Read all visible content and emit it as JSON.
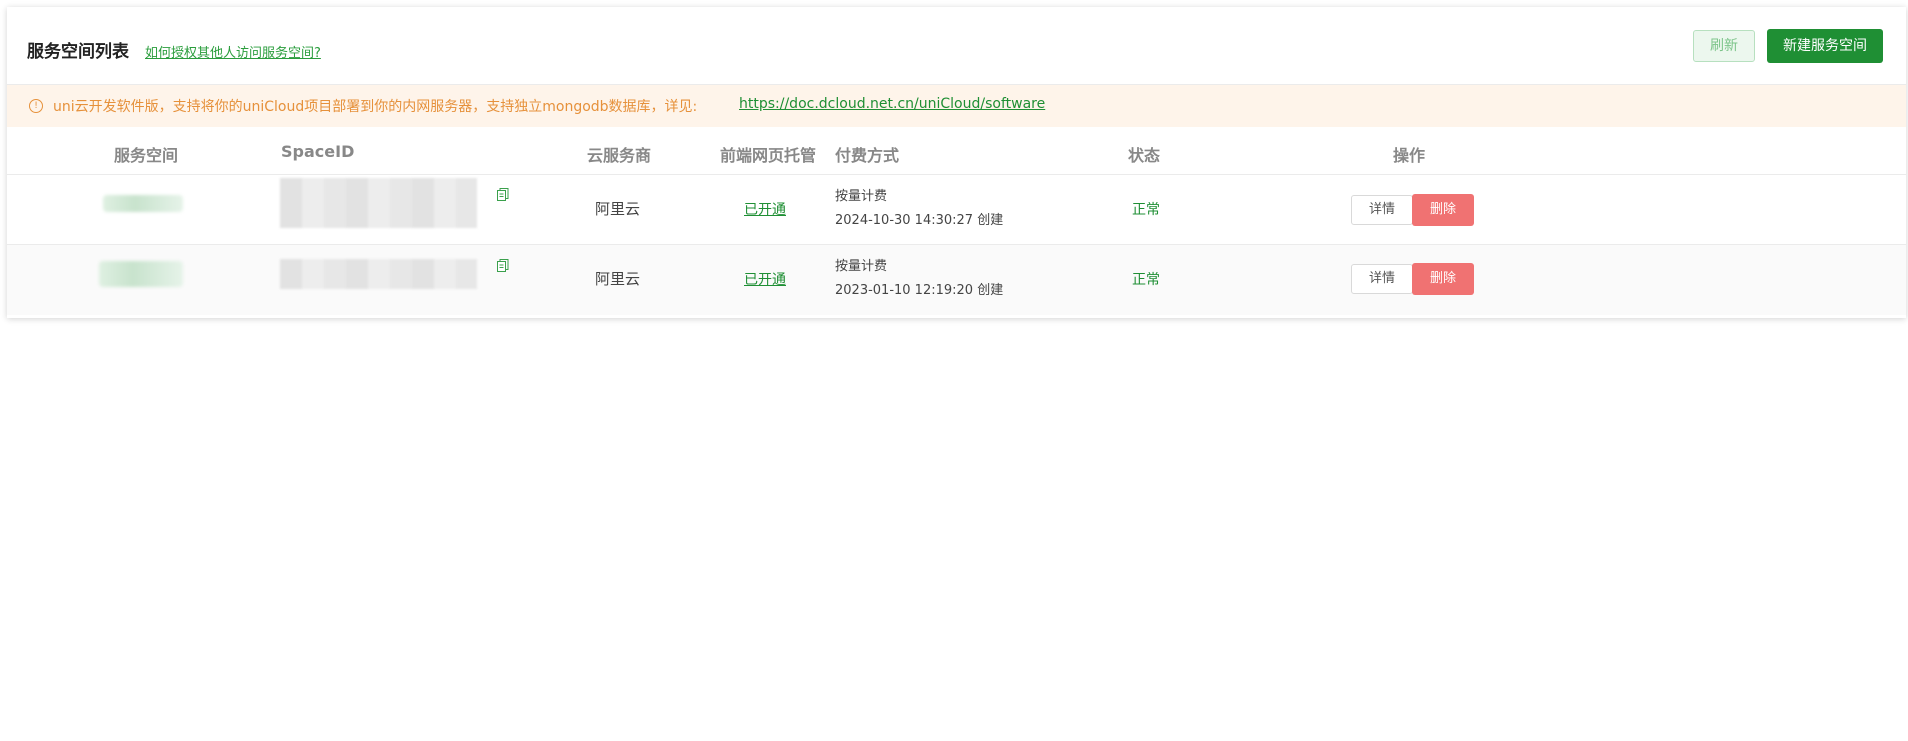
{
  "header": {
    "title": "服务空间列表",
    "help_link": "如何授权其他人访问服务空间?",
    "refresh_label": "刷新",
    "new_label": "新建服务空间"
  },
  "notice": {
    "icon": "info-icon",
    "text": "uni云开发软件版，支持将你的uniCloud项目部署到你的内网服务器，支持独立mongodb数据库，详见:",
    "link": "https://doc.dcloud.net.cn/uniCloud/software"
  },
  "table": {
    "columns": [
      "服务空间",
      "SpaceID",
      "云服务商",
      "前端网页托管",
      "付费方式",
      "状态",
      "操作"
    ],
    "rows": [
      {
        "provider": "阿里云",
        "hosting": "已开通",
        "billing": "按量计费",
        "created": "2024-10-30 14:30:27 创建",
        "status": "正常",
        "detail_label": "详情",
        "delete_label": "删除"
      },
      {
        "provider": "阿里云",
        "hosting": "已开通",
        "billing": "按量计费",
        "created": "2023-01-10 12:19:20 创建",
        "status": "正常",
        "detail_label": "详情",
        "delete_label": "删除"
      }
    ]
  },
  "colors": {
    "accent": "#1f8f34",
    "danger": "#f07272",
    "notice_bg": "#fef4ea",
    "notice_text": "#e6913b"
  }
}
